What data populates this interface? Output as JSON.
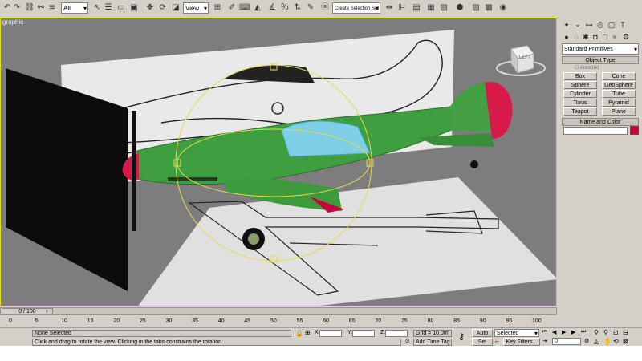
{
  "toolbar": {
    "selection_filter": "All",
    "ref_coord": "View",
    "named_selection": "Create Selection Set"
  },
  "viewport": {
    "label": "graphic",
    "viewcube_label": "LEFT"
  },
  "command_panel": {
    "category": "Standard Primitives",
    "object_type_title": "Object Type",
    "autogrid_label": "AutoGrid",
    "buttons": [
      "Box",
      "Cone",
      "Sphere",
      "GeoSphere",
      "Cylinder",
      "Tube",
      "Torus",
      "Pyramid",
      "Teapot",
      "Plane"
    ],
    "name_color_title": "Name and Color",
    "name_value": "",
    "object_color": "#c8003c"
  },
  "timeline": {
    "frame_display": "0 / 100",
    "ticks": [
      "0",
      "5",
      "10",
      "15",
      "20",
      "25",
      "30",
      "35",
      "40",
      "45",
      "50",
      "55",
      "60",
      "65",
      "70",
      "75",
      "80",
      "85",
      "90",
      "95",
      "100"
    ]
  },
  "status_bar": {
    "selection_status": "None Selected",
    "prompt": "Click and drag to rotate the view.  Clicking in the tabs constrains the rotation",
    "x_label": "X:",
    "y_label": "Y:",
    "z_label": "Z:",
    "grid": "Grid = 10.0m",
    "add_time_tag": "Add Time Tag",
    "auto_key": "Auto Key",
    "set_key": "Set Key",
    "key_mode": "Selected",
    "key_filters": "Key Filters...",
    "current_frame": "0"
  }
}
